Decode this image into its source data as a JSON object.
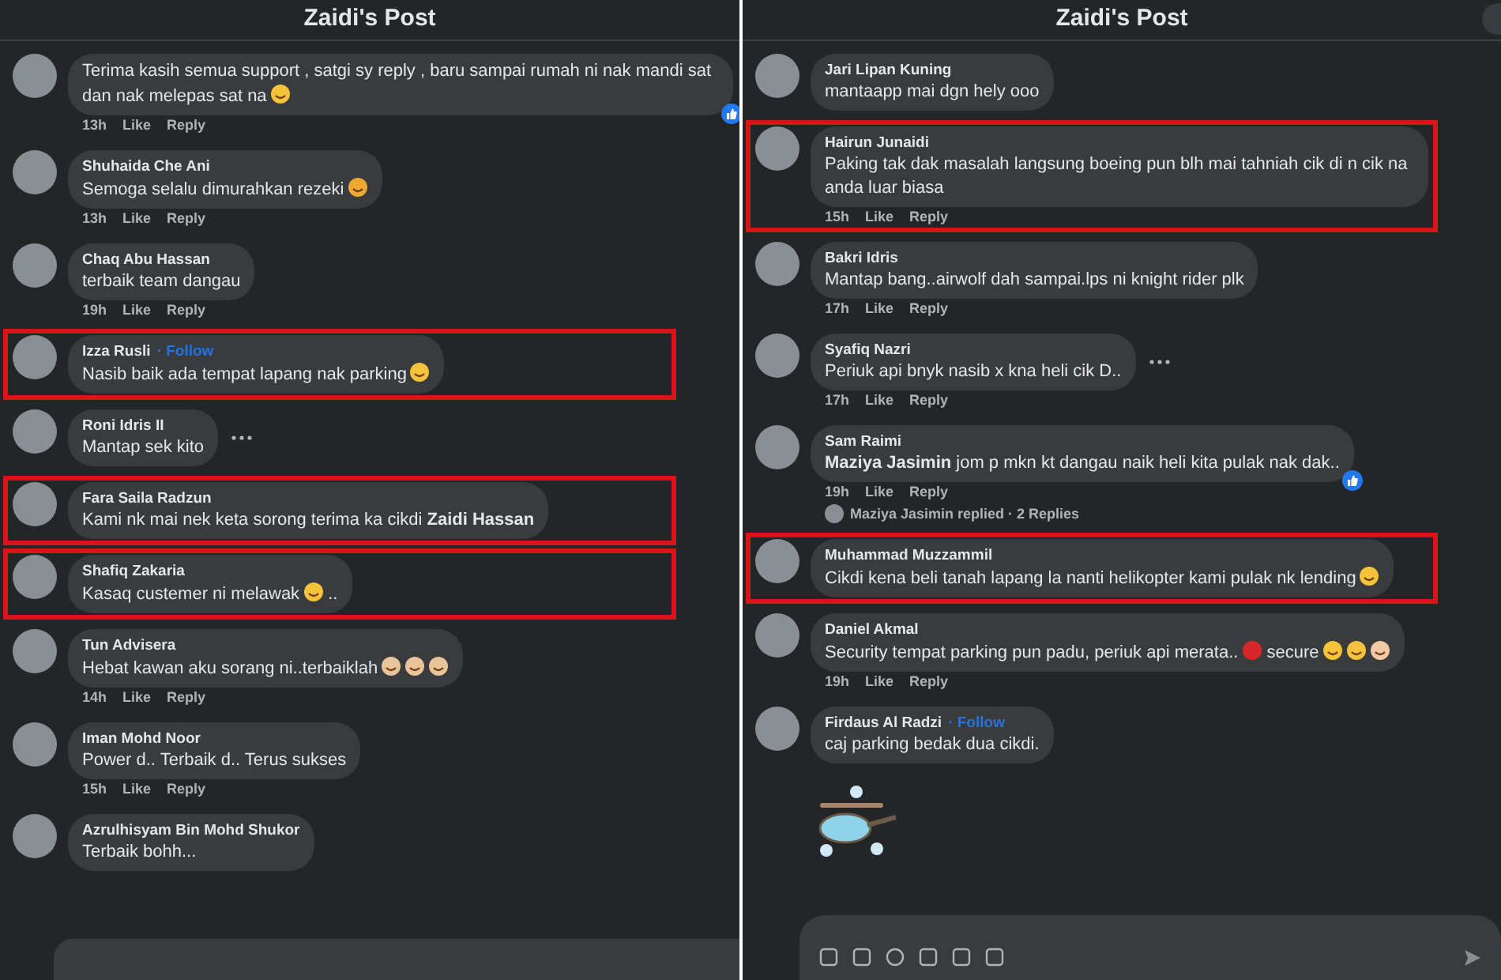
{
  "panels": [
    {
      "title": "Zaidi's Post",
      "comments": [
        {
          "text": "Terima kasih semua support , satgi sy reply , baru sampai rumah ni nak mandi sat dan nak melepas sat na",
          "emojis": [
            {
              "kind": "grin"
            }
          ],
          "time": "13h",
          "like": "Like",
          "reply": "Reply",
          "highlighted": false,
          "reaction_badge": true
        },
        {
          "name": "Shuhaida Che Ani",
          "text": "Semoga selalu dimurahkan rezeki",
          "emojis": [
            {
              "kind": "hands"
            }
          ],
          "time": "13h",
          "like": "Like",
          "reply": "Reply",
          "highlighted": false
        },
        {
          "name": "Chaq Abu Hassan",
          "text": "terbaik team dangau",
          "time": "19h",
          "like": "Like",
          "reply": "Reply",
          "highlighted": false
        },
        {
          "name": "Izza Rusli",
          "follow": "· Follow",
          "text": "Nasib baik ada tempat lapang nak parking",
          "emojis": [
            {
              "kind": "grin"
            }
          ],
          "highlighted": true
        },
        {
          "name": "Roni Idris II",
          "text": "Mantap sek kito",
          "highlighted": false,
          "more": true
        },
        {
          "name": "Fara Saila Radzun",
          "text": "Kami nk mai nek keta sorong terima ka cikdi **Zaidi Hassan**",
          "highlighted": true
        },
        {
          "name": "Shafiq Zakaria",
          "text": "Kasaq custemer ni melawak",
          "emojis": [
            {
              "kind": "rofl"
            }
          ],
          "suffix": "..",
          "highlighted": true
        },
        {
          "name": "Tun Advisera",
          "text": "Hebat kawan aku sorang ni..terbaiklah",
          "emojis": [
            {
              "kind": "clap"
            },
            {
              "kind": "clap"
            },
            {
              "kind": "clap"
            }
          ],
          "time": "14h",
          "like": "Like",
          "reply": "Reply",
          "highlighted": false
        },
        {
          "name": "Iman Mohd Noor",
          "text": "Power d.. Terbaik d.. Terus sukses",
          "time": "15h",
          "like": "Like",
          "reply": "Reply",
          "highlighted": false
        },
        {
          "name": "Azrulhisyam Bin Mohd Shukor",
          "text": "Terbaik bohh...",
          "highlighted": false
        }
      ],
      "composer": {
        "kind": "blurred"
      }
    },
    {
      "title": "Zaidi's Post",
      "close_button": true,
      "comments": [
        {
          "name": "Jari Lipan Kuning",
          "text": "mantaapp mai dgn hely ooo",
          "highlighted": false
        },
        {
          "name": "Hairun Junaidi",
          "text": "Paking tak dak masalah langsung boeing pun blh mai tahniah cik di n cik na anda luar biasa",
          "time": "15h",
          "like": "Like",
          "reply": "Reply",
          "highlighted": true
        },
        {
          "name": "Bakri Idris",
          "text": "Mantap bang..airwolf dah sampai.lps ni knight rider plk",
          "time": "17h",
          "like": "Like",
          "reply": "Reply",
          "highlighted": false
        },
        {
          "name": "Syafiq Nazri",
          "text": "Periuk api bnyk nasib x kna heli cik D..",
          "time": "17h",
          "like": "Like",
          "reply": "Reply",
          "highlighted": false,
          "more": true
        },
        {
          "name": "Sam Raimi",
          "text": "**Maziya Jasimin** jom p mkn kt dangau naik heli kita pulak nak dak..",
          "time": "19h",
          "like": "Like",
          "reply": "Reply",
          "highlighted": false,
          "reaction_badge": true,
          "replies": "Maziya Jasimin replied · 2 Replies"
        },
        {
          "name": "Muhammad Muzzammil",
          "text": "Cikdi kena beli tanah lapang la nanti helikopter kami pulak nk lending",
          "emojis": [
            {
              "kind": "grin"
            }
          ],
          "highlighted": true
        },
        {
          "name": "Daniel Akmal",
          "text": "Security tempat parking pun padu, periuk api merata..",
          "emojis": [
            {
              "kind": "hundred"
            }
          ],
          "suffix": "secure",
          "emojis2": [
            {
              "kind": "grin"
            },
            {
              "kind": "cry"
            },
            {
              "kind": "thumb"
            }
          ],
          "time": "19h",
          "like": "Like",
          "reply": "Reply",
          "highlighted": false
        },
        {
          "name": "Firdaus Al Radzi",
          "follow": "· Follow",
          "text": "caj parking bedak dua cikdi.",
          "sticker": {
            "kind": "helicopter"
          },
          "highlighted": false
        }
      ],
      "composer": {
        "kind": "toolbar"
      }
    }
  ]
}
